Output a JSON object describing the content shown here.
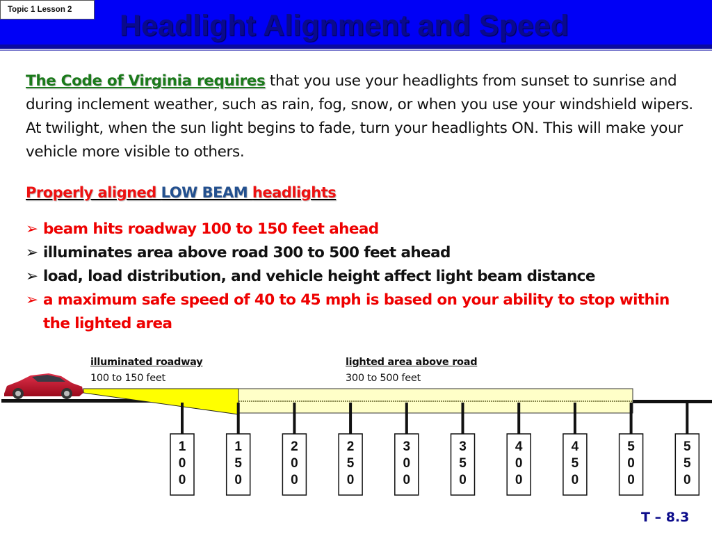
{
  "header": {
    "topic_label": "Topic 1 Lesson 2",
    "title": "Headlight Alignment and Speed",
    "colors": {
      "band": "#0000f6",
      "title": "#0a0a8c"
    }
  },
  "intro": {
    "lead": "The Code of Virginia requires",
    "text": " that you use your headlights from sunset to sunrise and during inclement weather, such as rain, fog, snow, or when you use your windshield wipers. At twilight, when the sun light begins to fade, turn your headlights ON.  This will make your vehicle more visible to others."
  },
  "subheading": {
    "part1": "Properly aligned ",
    "part2": "LOW BEAM ",
    "part3": "headlights"
  },
  "bullets": [
    {
      "text": "beam hits roadway 100 to 150 feet ahead",
      "color": "red"
    },
    {
      "text": "illuminates area above road 300 to 500 feet ahead",
      "color": "black"
    },
    {
      "text": "load, load distribution, and vehicle height affect light beam distance",
      "color": "black"
    },
    {
      "text": "a maximum safe speed of 40 to 45 mph is based on your ability to stop within the lighted area",
      "color": "red"
    }
  ],
  "diagram": {
    "illuminated": {
      "title": "illuminated roadway",
      "range": "100 to 150 feet"
    },
    "lighted": {
      "title": "lighted area above road",
      "range": "300 to 500 feet"
    },
    "markers": [
      "100",
      "150",
      "200",
      "250",
      "300",
      "350",
      "400",
      "450",
      "500",
      "550"
    ],
    "colors": {
      "beam": "#ffff00",
      "lighted_area": "#ffffc8",
      "car": "#c0102a"
    }
  },
  "footer": {
    "slide_number": "T – 8.3"
  }
}
